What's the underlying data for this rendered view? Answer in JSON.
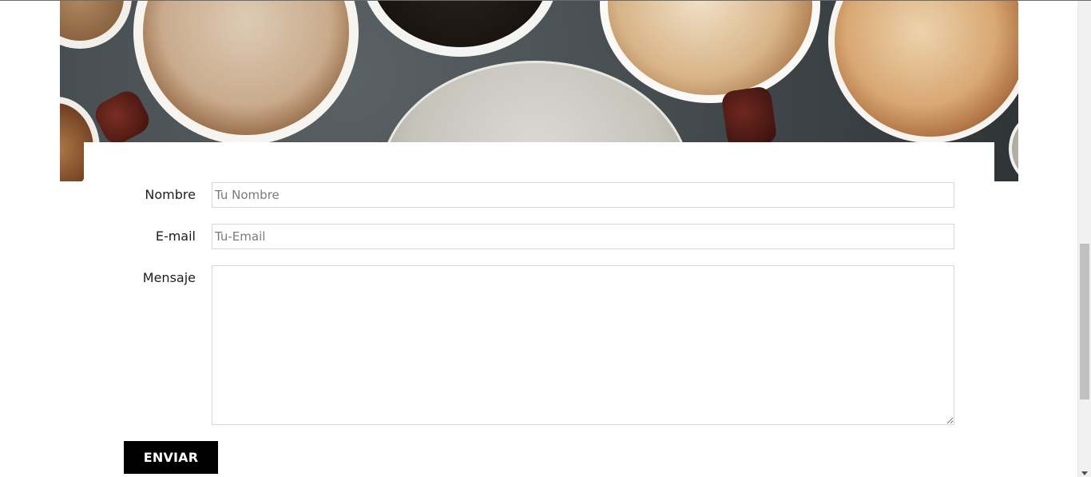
{
  "hero": {
    "image_description_icon": "coffee-cups-photo"
  },
  "form": {
    "name_label": "Nombre",
    "name_placeholder": "Tu Nombre",
    "name_value": "",
    "email_label": "E-mail",
    "email_placeholder": "Tu-Email",
    "email_value": "",
    "message_label": "Mensaje",
    "message_value": "",
    "submit_label": "ENVIAR"
  },
  "colors": {
    "button_bg": "#000000",
    "button_text": "#ffffff",
    "input_border": "#d6d6d6"
  },
  "scrollbar": {
    "scroll_position": 0.5
  }
}
